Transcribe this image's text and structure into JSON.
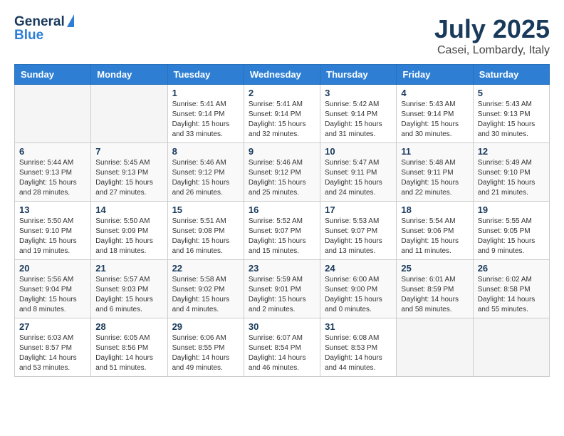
{
  "header": {
    "logo_general": "General",
    "logo_blue": "Blue",
    "month": "July 2025",
    "location": "Casei, Lombardy, Italy"
  },
  "days_of_week": [
    "Sunday",
    "Monday",
    "Tuesday",
    "Wednesday",
    "Thursday",
    "Friday",
    "Saturday"
  ],
  "weeks": [
    [
      {
        "day": "",
        "info": ""
      },
      {
        "day": "",
        "info": ""
      },
      {
        "day": "1",
        "info": "Sunrise: 5:41 AM\nSunset: 9:14 PM\nDaylight: 15 hours\nand 33 minutes."
      },
      {
        "day": "2",
        "info": "Sunrise: 5:41 AM\nSunset: 9:14 PM\nDaylight: 15 hours\nand 32 minutes."
      },
      {
        "day": "3",
        "info": "Sunrise: 5:42 AM\nSunset: 9:14 PM\nDaylight: 15 hours\nand 31 minutes."
      },
      {
        "day": "4",
        "info": "Sunrise: 5:43 AM\nSunset: 9:14 PM\nDaylight: 15 hours\nand 30 minutes."
      },
      {
        "day": "5",
        "info": "Sunrise: 5:43 AM\nSunset: 9:13 PM\nDaylight: 15 hours\nand 30 minutes."
      }
    ],
    [
      {
        "day": "6",
        "info": "Sunrise: 5:44 AM\nSunset: 9:13 PM\nDaylight: 15 hours\nand 28 minutes."
      },
      {
        "day": "7",
        "info": "Sunrise: 5:45 AM\nSunset: 9:13 PM\nDaylight: 15 hours\nand 27 minutes."
      },
      {
        "day": "8",
        "info": "Sunrise: 5:46 AM\nSunset: 9:12 PM\nDaylight: 15 hours\nand 26 minutes."
      },
      {
        "day": "9",
        "info": "Sunrise: 5:46 AM\nSunset: 9:12 PM\nDaylight: 15 hours\nand 25 minutes."
      },
      {
        "day": "10",
        "info": "Sunrise: 5:47 AM\nSunset: 9:11 PM\nDaylight: 15 hours\nand 24 minutes."
      },
      {
        "day": "11",
        "info": "Sunrise: 5:48 AM\nSunset: 9:11 PM\nDaylight: 15 hours\nand 22 minutes."
      },
      {
        "day": "12",
        "info": "Sunrise: 5:49 AM\nSunset: 9:10 PM\nDaylight: 15 hours\nand 21 minutes."
      }
    ],
    [
      {
        "day": "13",
        "info": "Sunrise: 5:50 AM\nSunset: 9:10 PM\nDaylight: 15 hours\nand 19 minutes."
      },
      {
        "day": "14",
        "info": "Sunrise: 5:50 AM\nSunset: 9:09 PM\nDaylight: 15 hours\nand 18 minutes."
      },
      {
        "day": "15",
        "info": "Sunrise: 5:51 AM\nSunset: 9:08 PM\nDaylight: 15 hours\nand 16 minutes."
      },
      {
        "day": "16",
        "info": "Sunrise: 5:52 AM\nSunset: 9:07 PM\nDaylight: 15 hours\nand 15 minutes."
      },
      {
        "day": "17",
        "info": "Sunrise: 5:53 AM\nSunset: 9:07 PM\nDaylight: 15 hours\nand 13 minutes."
      },
      {
        "day": "18",
        "info": "Sunrise: 5:54 AM\nSunset: 9:06 PM\nDaylight: 15 hours\nand 11 minutes."
      },
      {
        "day": "19",
        "info": "Sunrise: 5:55 AM\nSunset: 9:05 PM\nDaylight: 15 hours\nand 9 minutes."
      }
    ],
    [
      {
        "day": "20",
        "info": "Sunrise: 5:56 AM\nSunset: 9:04 PM\nDaylight: 15 hours\nand 8 minutes."
      },
      {
        "day": "21",
        "info": "Sunrise: 5:57 AM\nSunset: 9:03 PM\nDaylight: 15 hours\nand 6 minutes."
      },
      {
        "day": "22",
        "info": "Sunrise: 5:58 AM\nSunset: 9:02 PM\nDaylight: 15 hours\nand 4 minutes."
      },
      {
        "day": "23",
        "info": "Sunrise: 5:59 AM\nSunset: 9:01 PM\nDaylight: 15 hours\nand 2 minutes."
      },
      {
        "day": "24",
        "info": "Sunrise: 6:00 AM\nSunset: 9:00 PM\nDaylight: 15 hours\nand 0 minutes."
      },
      {
        "day": "25",
        "info": "Sunrise: 6:01 AM\nSunset: 8:59 PM\nDaylight: 14 hours\nand 58 minutes."
      },
      {
        "day": "26",
        "info": "Sunrise: 6:02 AM\nSunset: 8:58 PM\nDaylight: 14 hours\nand 55 minutes."
      }
    ],
    [
      {
        "day": "27",
        "info": "Sunrise: 6:03 AM\nSunset: 8:57 PM\nDaylight: 14 hours\nand 53 minutes."
      },
      {
        "day": "28",
        "info": "Sunrise: 6:05 AM\nSunset: 8:56 PM\nDaylight: 14 hours\nand 51 minutes."
      },
      {
        "day": "29",
        "info": "Sunrise: 6:06 AM\nSunset: 8:55 PM\nDaylight: 14 hours\nand 49 minutes."
      },
      {
        "day": "30",
        "info": "Sunrise: 6:07 AM\nSunset: 8:54 PM\nDaylight: 14 hours\nand 46 minutes."
      },
      {
        "day": "31",
        "info": "Sunrise: 6:08 AM\nSunset: 8:53 PM\nDaylight: 14 hours\nand 44 minutes."
      },
      {
        "day": "",
        "info": ""
      },
      {
        "day": "",
        "info": ""
      }
    ]
  ]
}
